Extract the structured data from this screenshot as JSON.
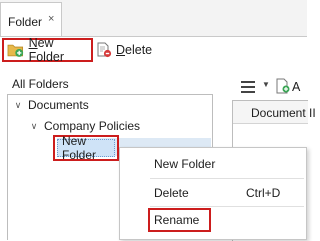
{
  "tab": {
    "label": "Folder",
    "close_glyph": "×"
  },
  "toolbar": {
    "new_folder": {
      "label_underlined": "N",
      "label_rest": "ew Folder",
      "icon": "folder-add-icon"
    },
    "delete": {
      "label_underlined": "D",
      "label_rest": "elete",
      "icon": "delete-document-icon"
    }
  },
  "folders_panel": {
    "title": "All Folders"
  },
  "tree": {
    "items": [
      {
        "label": "Documents",
        "expanded": true
      },
      {
        "label": "Company Policies",
        "expanded": true
      },
      {
        "label": "New Folder",
        "selected": true
      }
    ]
  },
  "grid": {
    "header": "Document II",
    "toolbar_text": "A"
  },
  "context_menu": {
    "items": [
      {
        "label": "New Folder",
        "shortcut": ""
      },
      {
        "label": "Delete",
        "shortcut": "Ctrl+D"
      },
      {
        "label": "Rename",
        "shortcut": ""
      }
    ]
  },
  "colors": {
    "highlight_red": "#cc1d1d",
    "selection_blue": "#cfe3f7",
    "icon_green": "#3aa655",
    "folder_yellow": "#e7b94a"
  }
}
